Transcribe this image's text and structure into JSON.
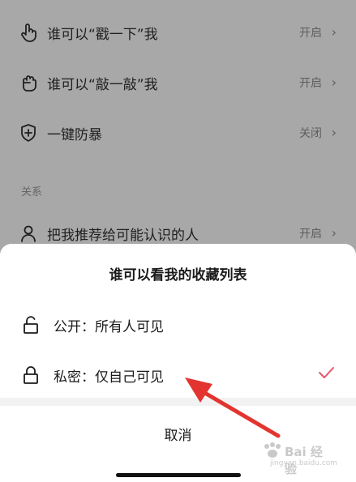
{
  "settings": {
    "rows": [
      {
        "label": "谁可以“戳一下”我",
        "value": "开启",
        "icon": "poke-hand-icon"
      },
      {
        "label": "谁可以“敲一敲”我",
        "value": "开启",
        "icon": "knock-fist-icon"
      },
      {
        "label": "一键防暴",
        "value": "关闭",
        "icon": "shield-plus-icon"
      }
    ],
    "section_title": "关系",
    "relation_row": {
      "label": "把我推荐给可能认识的人",
      "value": "开启",
      "icon": "user-icon"
    }
  },
  "sheet": {
    "title": "谁可以看我的收藏列表",
    "options": [
      {
        "label": "公开：所有人可见",
        "icon": "unlock-icon",
        "selected": false
      },
      {
        "label": "私密：仅自己可见",
        "icon": "lock-icon",
        "selected": true
      }
    ],
    "cancel_label": "取消"
  },
  "watermark": {
    "brand": "Bai 经验",
    "sub": "jingyan.baidu.com"
  },
  "colors": {
    "check": "#e8526b",
    "arrow": "#e3342f",
    "overlay": "#a8a8a8"
  }
}
